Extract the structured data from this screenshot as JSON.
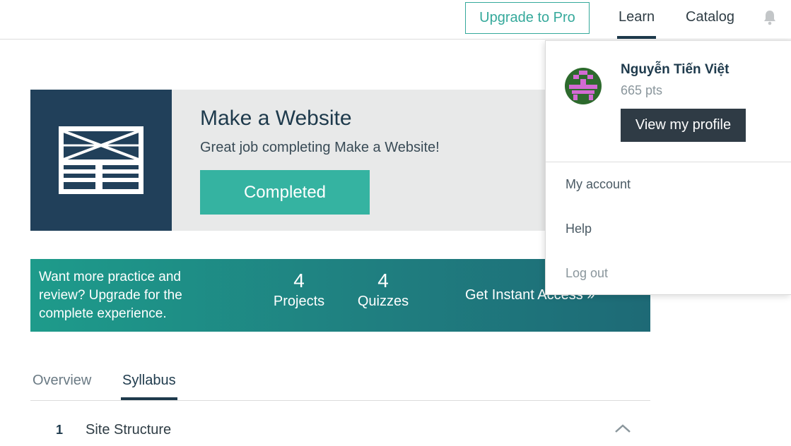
{
  "nav": {
    "upgrade_label": "Upgrade to Pro",
    "learn_label": "Learn",
    "catalog_label": "Catalog",
    "bell_icon": "bell-icon"
  },
  "course": {
    "title": "Make a Website",
    "subtitle": "Great job completing Make a Website!",
    "status_label": "Completed",
    "icon": "website-layout-icon"
  },
  "banner": {
    "text": "Want more practice and review? Upgrade for the complete experience.",
    "projects_count": "4",
    "projects_label": "Projects",
    "quizzes_count": "4",
    "quizzes_label": "Quizzes",
    "access_label": "Get Instant Access »"
  },
  "tabs": [
    {
      "label": "Overview",
      "active": false
    },
    {
      "label": "Syllabus",
      "active": true
    }
  ],
  "syllabus": [
    {
      "number": "1",
      "title": "Site Structure",
      "expanded": true
    }
  ],
  "profile_menu": {
    "user_name": "Nguyễn Tiến Việt",
    "points": "665 pts",
    "view_profile_label": "View my profile",
    "items": [
      {
        "label": "My account"
      },
      {
        "label": "Help"
      },
      {
        "label": "Log out"
      }
    ]
  },
  "colors": {
    "accent": "#35b3a1",
    "navy": "#21405a",
    "dark_button": "#2f3b45"
  }
}
